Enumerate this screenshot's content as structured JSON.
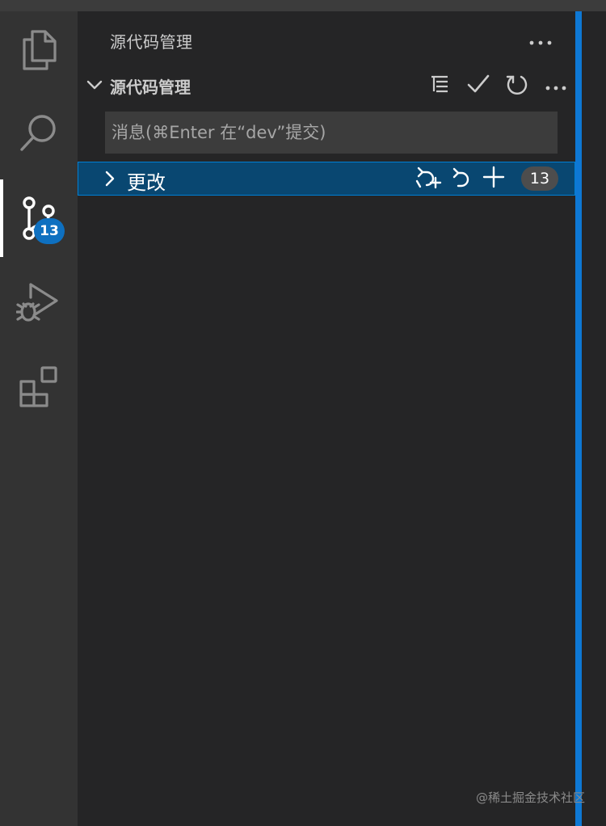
{
  "activity_bar": {
    "items": [
      {
        "name": "explorer",
        "icon": "files-icon"
      },
      {
        "name": "search",
        "icon": "search-icon"
      },
      {
        "name": "source-control",
        "icon": "source-control-icon",
        "active": true,
        "badge": "13"
      },
      {
        "name": "run-debug",
        "icon": "run-debug-icon"
      },
      {
        "name": "extensions",
        "icon": "extensions-icon"
      }
    ],
    "scm_badge": "13"
  },
  "sidebar": {
    "title": "源代码管理",
    "more_icon": "ellipsis-icon",
    "section": {
      "title": "源代码管理",
      "actions": [
        {
          "name": "view-as-tree",
          "icon": "list-tree-icon"
        },
        {
          "name": "commit",
          "icon": "check-icon"
        },
        {
          "name": "refresh",
          "icon": "refresh-icon"
        },
        {
          "name": "more-actions",
          "icon": "ellipsis-icon"
        }
      ]
    },
    "commit_input": {
      "placeholder": "消息(⌘Enter 在“dev”提交)",
      "value": ""
    },
    "changes": {
      "label": "更改",
      "count": "13",
      "actions": [
        {
          "name": "open-changes",
          "icon": "discard-stage-icon"
        },
        {
          "name": "discard-all",
          "icon": "discard-icon"
        },
        {
          "name": "stage-all",
          "icon": "plus-icon"
        }
      ]
    }
  },
  "watermark": "@稀土掘金技术社区",
  "colors": {
    "activity_bar_bg": "#333333",
    "sidebar_bg": "#252526",
    "selection_bg": "#094771",
    "selection_border": "#007fd4",
    "badge_blue": "#0e70c0",
    "accent_edge": "#0e78d4"
  }
}
